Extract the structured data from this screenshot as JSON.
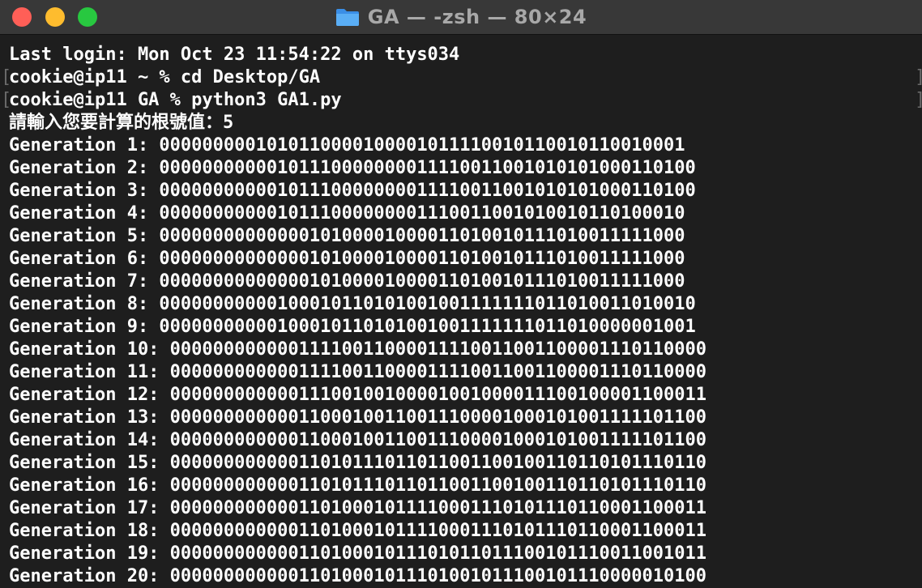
{
  "window": {
    "title": "GA — -zsh — 80×24",
    "folder_icon": "folder-icon",
    "colors": {
      "close": "#ff5f57",
      "minimize": "#febc2e",
      "zoom": "#28c840",
      "background": "#1e1e1e",
      "text": "#ffffff"
    }
  },
  "terminal": {
    "marker_left": "[",
    "marker_right": "]",
    "lines": [
      "Last login: Mon Oct 23 11:54:22 on ttys034",
      "cookie@ip11 ~ % cd Desktop/GA",
      "cookie@ip11 GA % python3 GA1.py",
      "請輸入您要計算的根號值：5",
      "Generation 1: 0000000001010110000100001011110010110010110010001",
      "Generation 2: 000000000001011100000000111100110010101010001101 00",
      "Generation 3: 00000000000101110000000011110011001010101000110100",
      "Generation 4: 00000000000101110000000011100110010100101101000 10",
      "Generation 5: 00000000000000101000010000110100101110100111110 00",
      "Generation 6: 00000000000000101000010000110100101110100111110 00",
      "Generation 7: 00000000000000101000010000110100101110100111110 00",
      "Generation 8: 00000000000100010110101001001111111011010011010 010",
      "Generation 9: 00000000000100010110101001001111111011010000001001",
      "Generation 10: 00000000000011110011000011110011001100001110110000",
      "Generation 11: 00000000000011110011000011110011001100001110110000",
      "Generation 12: 00000000000011100100100001001000011100100001100011",
      "Generation 13: 00000000000011000100110011100001000101001111101100",
      "Generation 14: 00000000000011000100110011100001000101001111101100",
      "Generation 15: 00000000000011010111011011001100100110110101110110",
      "Generation 16: 00000000000011010111011011001100100110110101110110",
      "Generation 17: 00000000000011010001011110001110101110110001100011",
      "Generation 18: 00000000000011010001011110001110101110110001100011",
      "Generation 19: 00000000000011010001011101011011100101110011001011",
      "Generation 20: 00000000000011010001011101001011100101110000010100"
    ]
  }
}
